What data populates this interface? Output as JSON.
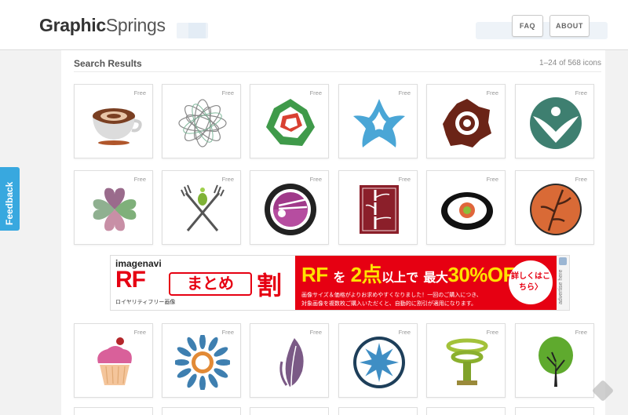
{
  "header": {
    "logo_bold": "Graphic",
    "logo_regular": "Springs",
    "nav": [
      {
        "label": "FAQ"
      },
      {
        "label": "ABOUT"
      }
    ]
  },
  "results": {
    "title": "Search Results",
    "count": "1–24 of 568 icons"
  },
  "tiles": [
    {
      "badge": "Free",
      "icon": "coffee-cup-icon"
    },
    {
      "badge": "Free",
      "icon": "wire-flower-icon"
    },
    {
      "badge": "Free",
      "icon": "green-red-flower-icon"
    },
    {
      "badge": "Free",
      "icon": "blue-star-icon"
    },
    {
      "badge": "Free",
      "icon": "brown-flower-icon"
    },
    {
      "badge": "Free",
      "icon": "person-circle-icon"
    },
    {
      "badge": "Free",
      "icon": "heart-clover-icon"
    },
    {
      "badge": "Free",
      "icon": "fork-knife-icon"
    },
    {
      "badge": "Free",
      "icon": "chopsticks-plate-icon"
    },
    {
      "badge": "Free",
      "icon": "bamboo-frame-icon"
    },
    {
      "badge": "Free",
      "icon": "sushi-roll-icon"
    },
    {
      "badge": "Free",
      "icon": "branch-circle-icon"
    },
    {
      "badge": "Free",
      "icon": "cupcake-icon"
    },
    {
      "badge": "Free",
      "icon": "sunflower-icon"
    },
    {
      "badge": "Free",
      "icon": "leaf-icon"
    },
    {
      "badge": "Free",
      "icon": "snowflake-circle-icon"
    },
    {
      "badge": "Free",
      "icon": "spiral-tree-icon"
    },
    {
      "badge": "Free",
      "icon": "green-tree-icon"
    }
  ],
  "ad": {
    "brand": "imagenavi",
    "rf": "RF",
    "matome": "まとめ",
    "wari": "割",
    "sub": "ロイヤリティフリー画像",
    "headline_a": "RF",
    "headline_b": "を",
    "headline_c": "2点",
    "headline_d": "以上で",
    "headline_e": "最大",
    "headline_f": "30%OFF",
    "line1": "画像サイズ＆価格がよりお求めやすくなりました！一回のご購入につき、",
    "line2": "対象画像を複数枚ご購入いただくと、自動的に割引が適用になります。",
    "cta": "詳しくはこちら〉",
    "side": "advertise here"
  },
  "feedback": "Feedback",
  "colors": {
    "accent_blue": "#38a8df",
    "ad_red": "#e60012",
    "ad_yellow": "#ffe100"
  }
}
